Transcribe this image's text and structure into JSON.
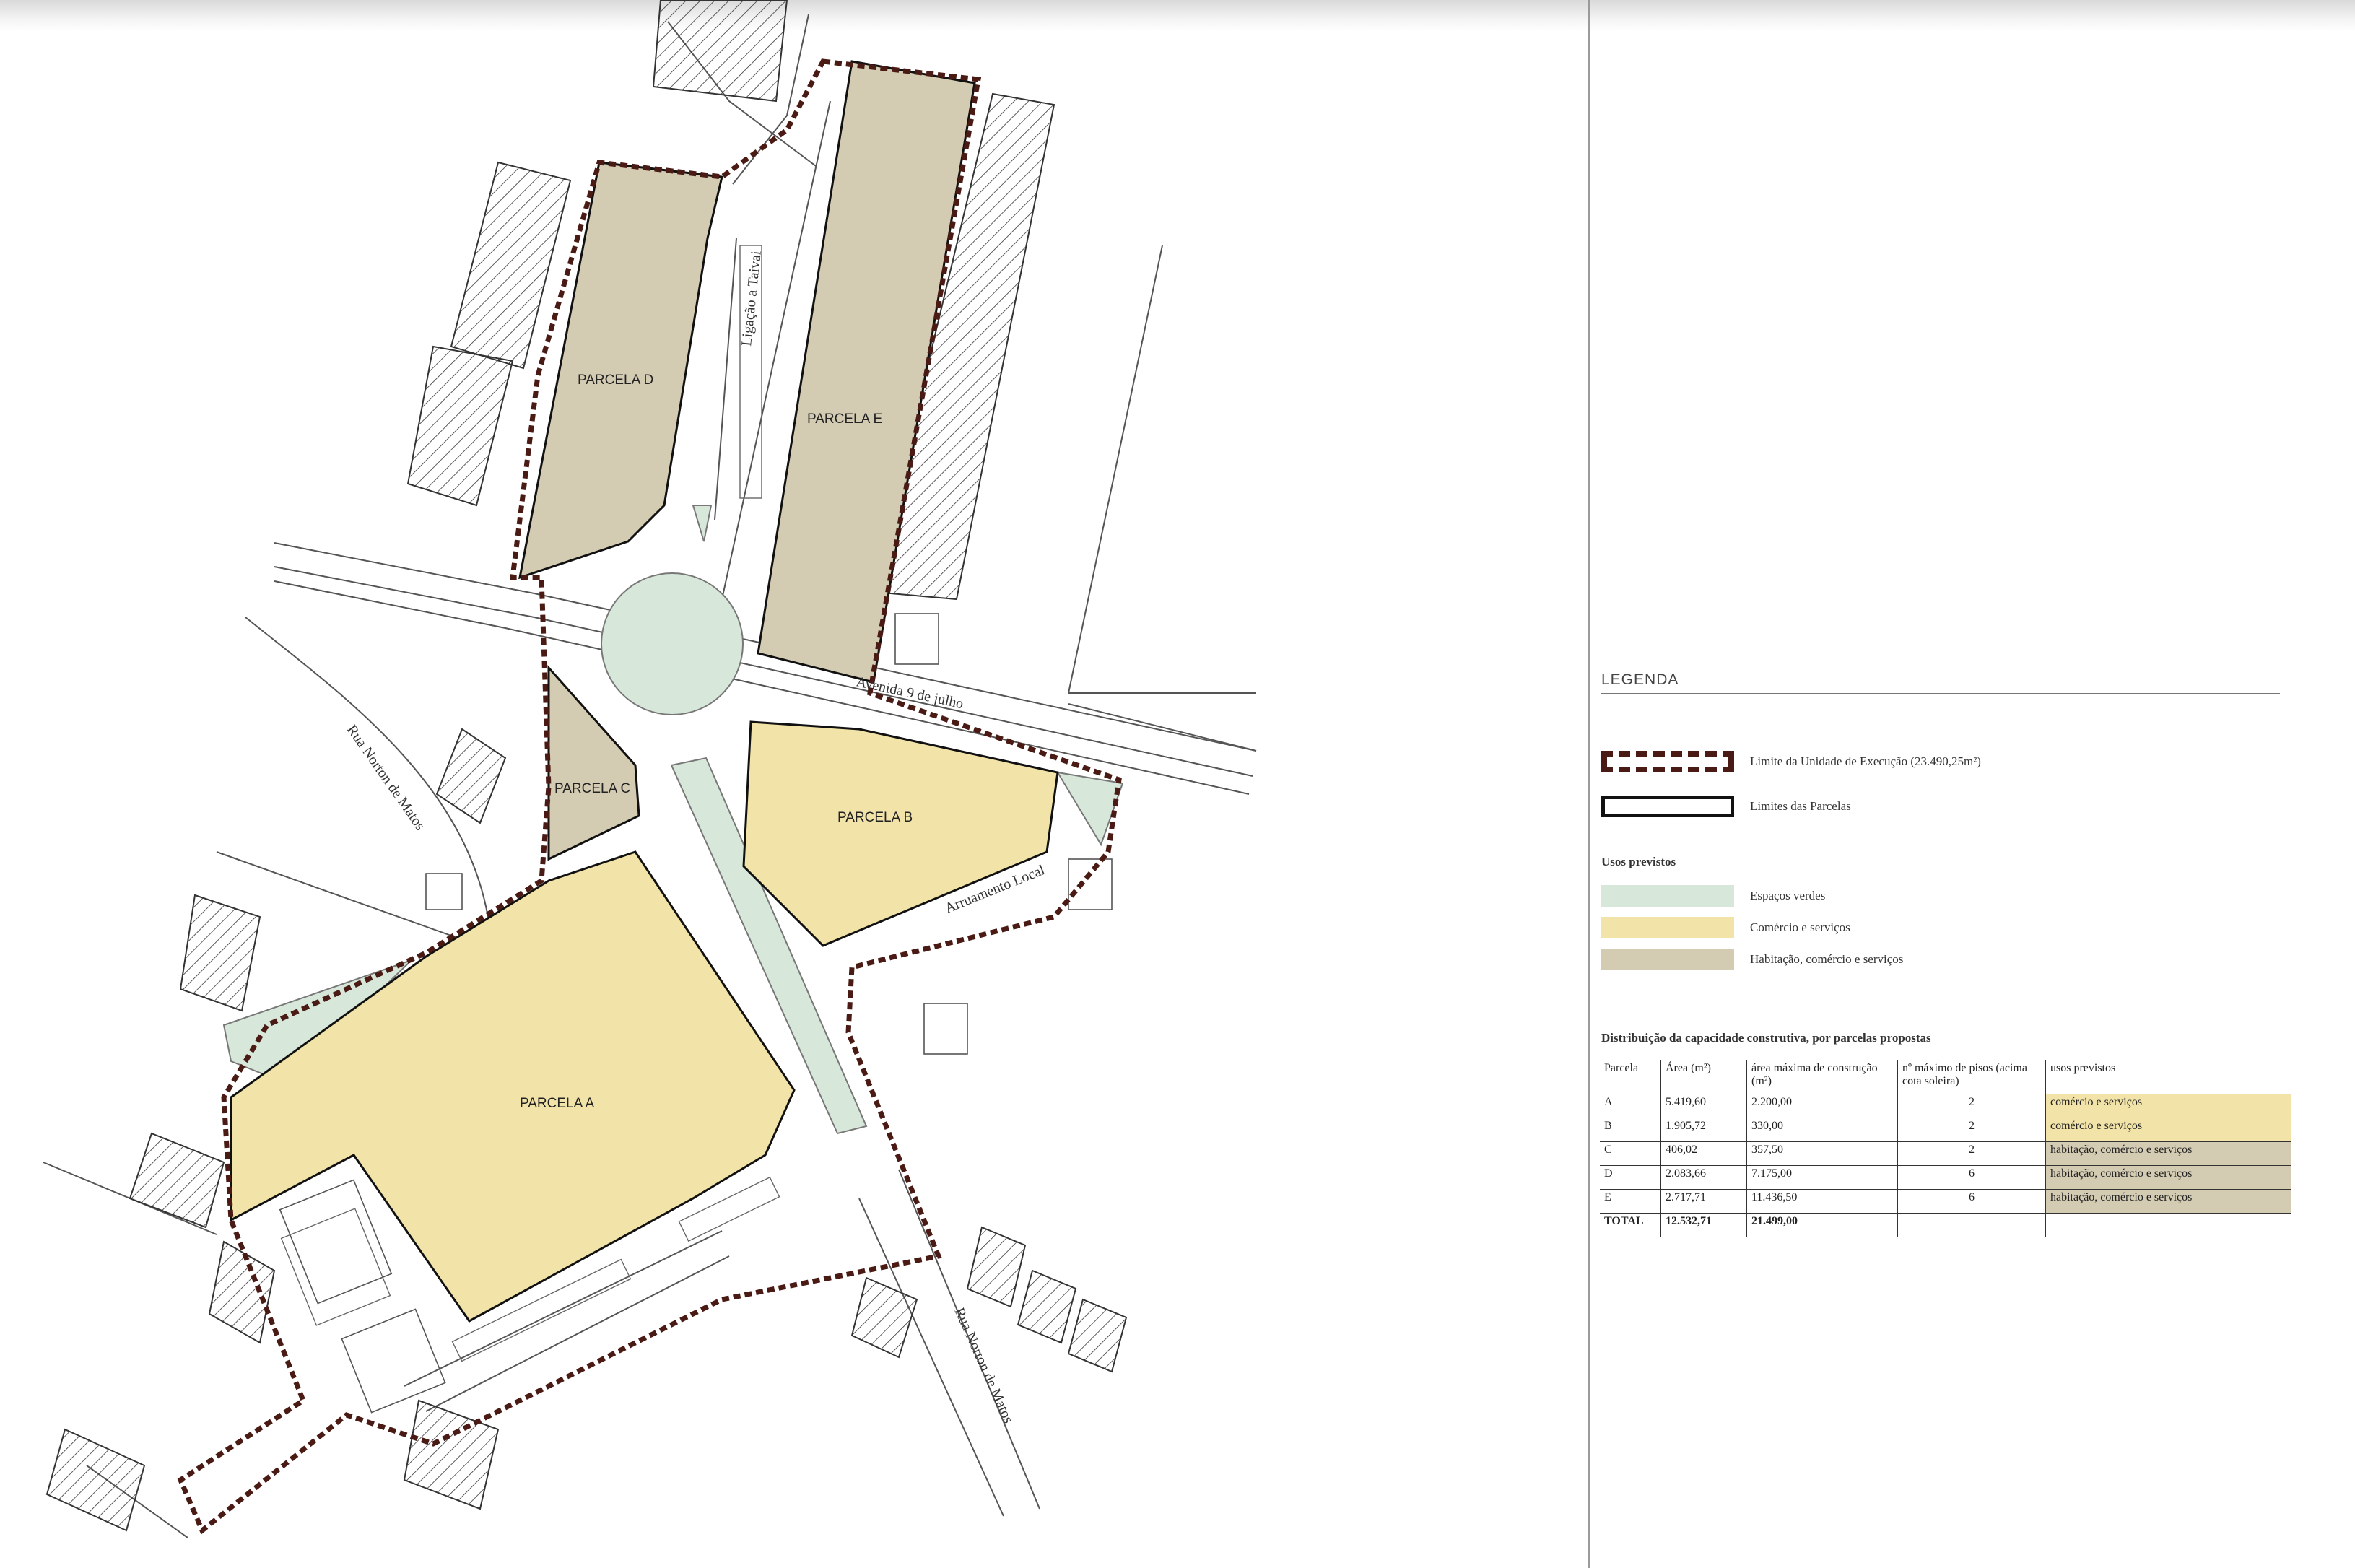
{
  "colors": {
    "espacos_verdes": "#d7e8da",
    "comercio_servicos": "#f2e3a8",
    "habitacao_comercio_servicos": "#d4cbb3",
    "ue_limit": "#4a1a14"
  },
  "map": {
    "parcels": [
      {
        "id": "A",
        "label": "PARCELA A"
      },
      {
        "id": "B",
        "label": "PARCELA B"
      },
      {
        "id": "C",
        "label": "PARCELA C"
      },
      {
        "id": "D",
        "label": "PARCELA D"
      },
      {
        "id": "E",
        "label": "PARCELA E"
      }
    ],
    "streets": {
      "ligacao_taivai": "Ligação a Taivai",
      "avenida_9_julho": "Avenida 9 de julho",
      "rua_norton_matos_1": "Rua Norton de Matos",
      "rua_norton_matos_2": "Rua Norton de Matos",
      "arruamento_local": "Arruamento Local"
    }
  },
  "legend": {
    "title": "LEGENDA",
    "ue_limit": "Limite da Unidade de Execução (23.490,25m²)",
    "parcel_limits": "Limites das Parcelas",
    "usos_title": "Usos previstos",
    "usos": [
      {
        "key": "espacos_verdes",
        "label": "Espaços verdes"
      },
      {
        "key": "comercio_servicos",
        "label": "Comércio e serviços"
      },
      {
        "key": "habitacao_comercio_servicos",
        "label": "Habitação, comércio e serviços"
      }
    ]
  },
  "distribution": {
    "title": "Distribuição da capacidade construtiva, por parcelas  propostas",
    "headers": [
      "Parcela",
      "Área (m²)",
      "área máxima de construção (m²)",
      "nº máximo de pisos (acima cota soleira)",
      "usos previstos"
    ],
    "rows": [
      {
        "parcela": "A",
        "area": "5.419,60",
        "area_construcao": "2.200,00",
        "pisos": "2",
        "usos": "comércio e serviços",
        "use_key": "comercio_servicos"
      },
      {
        "parcela": "B",
        "area": "1.905,72",
        "area_construcao": "330,00",
        "pisos": "2",
        "usos": "comércio e serviços",
        "use_key": "comercio_servicos"
      },
      {
        "parcela": "C",
        "area": "406,02",
        "area_construcao": "357,50",
        "pisos": "2",
        "usos": "habitação, comércio e serviços",
        "use_key": "habitacao_comercio_servicos"
      },
      {
        "parcela": "D",
        "area": "2.083,66",
        "area_construcao": "7.175,00",
        "pisos": "6",
        "usos": "habitação, comércio e serviços",
        "use_key": "habitacao_comercio_servicos"
      },
      {
        "parcela": "E",
        "area": "2.717,71",
        "area_construcao": "11.436,50",
        "pisos": "6",
        "usos": "habitação, comércio e serviços",
        "use_key": "habitacao_comercio_servicos"
      }
    ],
    "total": {
      "label": "TOTAL",
      "area": "12.532,71",
      "area_construcao": "21.499,00"
    }
  }
}
